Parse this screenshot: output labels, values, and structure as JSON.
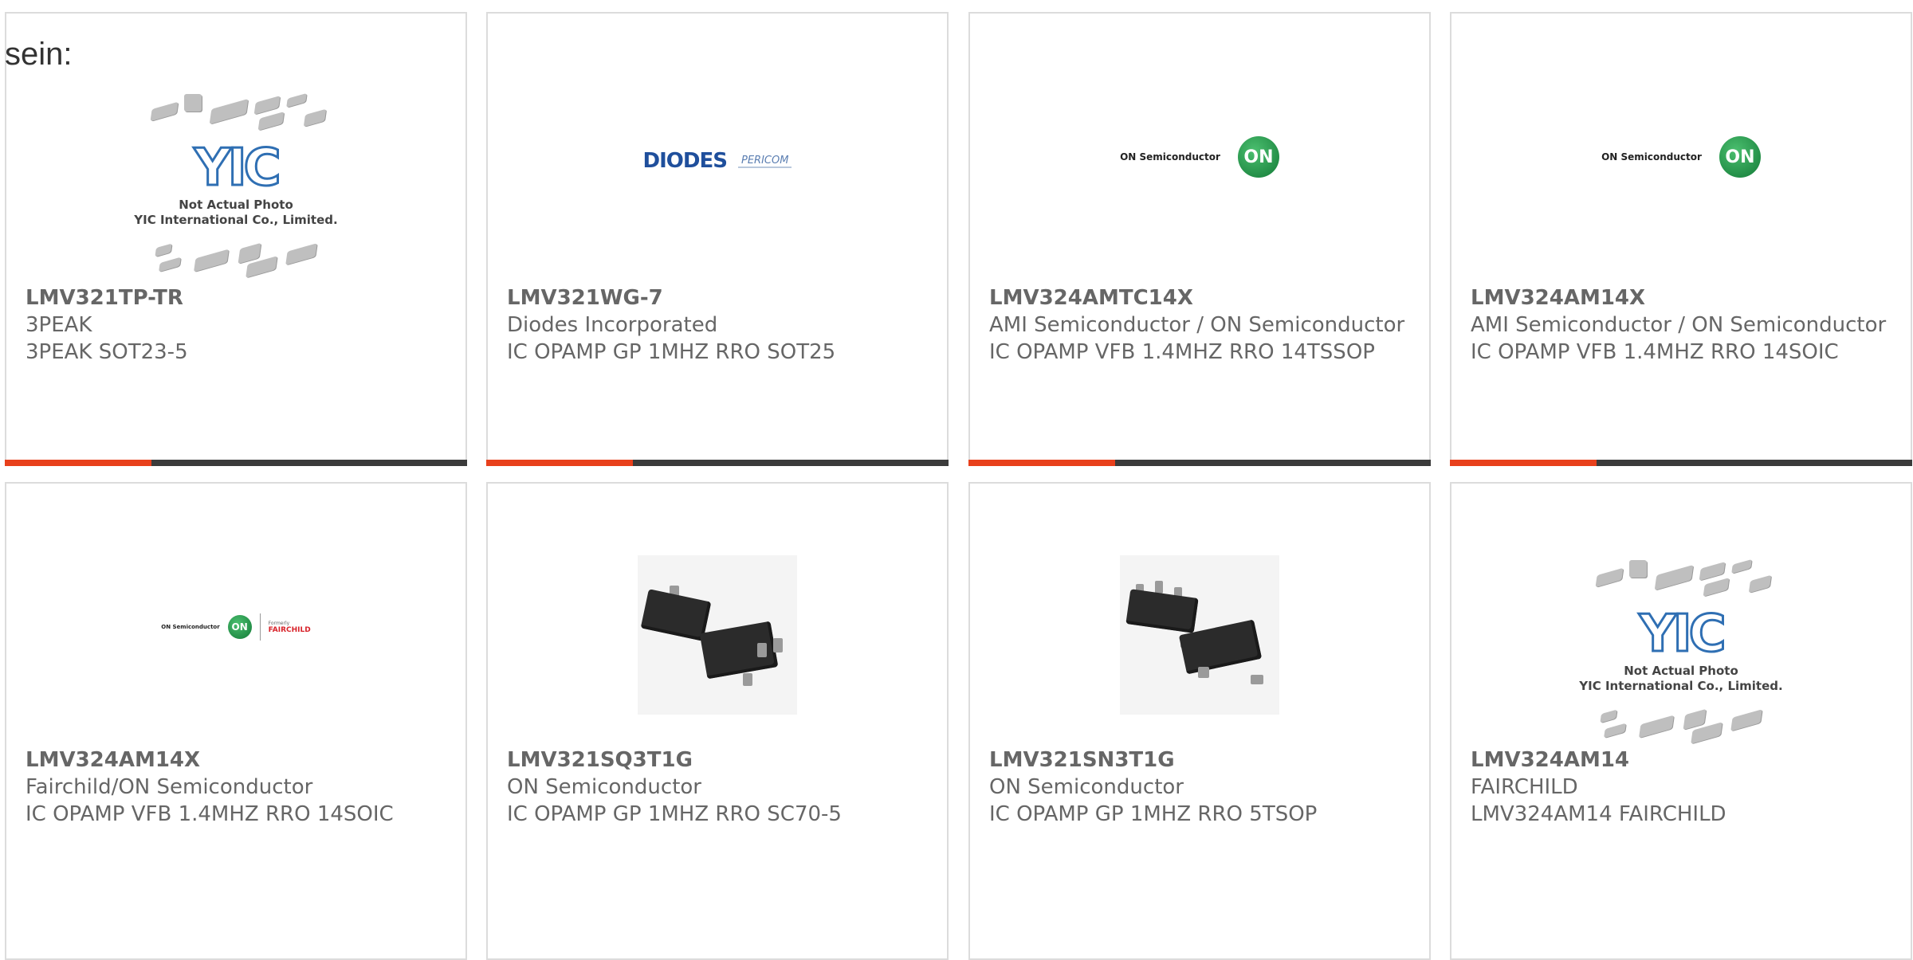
{
  "intro_text": "sein:",
  "colors": {
    "accent": "#e8401c",
    "bar": "#3b3b3b",
    "text": "#666666",
    "border": "#dcdcdc"
  },
  "yic_image": {
    "logo": "YIC",
    "caption_line1": "Not Actual Photo",
    "caption_line2": "YIC International Co., Limited."
  },
  "logos": {
    "diodes": "DIODES",
    "pericom": "PERICOM",
    "on_semiconductor": "ON Semiconductor",
    "on": "ON",
    "formerly": "Formerly",
    "fairchild": "FAIRCHILD"
  },
  "products": [
    {
      "part_number": "LMV321TP-TR",
      "manufacturer": "3PEAK",
      "description": "3PEAK SOT23-5",
      "image": "yic-placeholder"
    },
    {
      "part_number": "LMV321WG-7",
      "manufacturer": "Diodes Incorporated",
      "description": "IC OPAMP GP 1MHZ RRO SOT25",
      "image": "diodes-logo"
    },
    {
      "part_number": "LMV324AMTC14X",
      "manufacturer": "AMI Semiconductor / ON Semiconductor",
      "description": "IC OPAMP VFB 1.4MHZ RRO 14TSSOP",
      "image": "on-semi-logo"
    },
    {
      "part_number": "LMV324AM14X",
      "manufacturer": "AMI Semiconductor / ON Semiconductor",
      "description": "IC OPAMP VFB 1.4MHZ RRO 14SOIC",
      "image": "on-semi-logo"
    },
    {
      "part_number": "LMV324AM14X",
      "manufacturer": "Fairchild/ON Semiconductor",
      "description": "IC OPAMP VFB 1.4MHZ RRO 14SOIC",
      "image": "on-fairchild-logo"
    },
    {
      "part_number": "LMV321SQ3T1G",
      "manufacturer": "ON Semiconductor",
      "description": "IC OPAMP GP 1MHZ RRO SC70-5",
      "image": "sc70-package-photo"
    },
    {
      "part_number": "LMV321SN3T1G",
      "manufacturer": "ON Semiconductor",
      "description": "IC OPAMP GP 1MHZ RRO 5TSOP",
      "image": "tsop-package-photo"
    },
    {
      "part_number": "LMV324AM14",
      "manufacturer": "FAIRCHILD",
      "description": "LMV324AM14 FAIRCHILD",
      "image": "yic-placeholder"
    }
  ]
}
